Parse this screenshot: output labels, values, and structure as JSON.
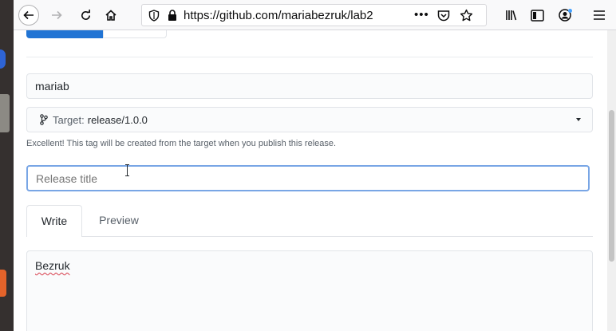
{
  "browser": {
    "url": "https://github.com/mariabezruk/lab2",
    "url_overflow": "•••",
    "icons": {
      "back": "arrow-left-icon",
      "forward": "arrow-right-icon",
      "reload": "reload-icon",
      "home": "home-icon",
      "tracking": "shield-icon",
      "secure": "lock-icon",
      "pocket": "pocket-icon",
      "bookmark": "star-icon",
      "library": "library-icon",
      "sidebar": "sidebar-icon",
      "account": "account-icon",
      "menu": "hamburger-menu-icon"
    }
  },
  "form": {
    "tag_value": "mariab",
    "target_label": "Target:",
    "target_value": "release/1.0.0",
    "hint": "Excellent! This tag will be created from the target when you publish this release.",
    "title_placeholder": "Release title",
    "tabs": [
      {
        "label": "Write",
        "active": true
      },
      {
        "label": "Preview",
        "active": false
      }
    ],
    "description": "Bezruk"
  },
  "colors": {
    "primary_button": "#2174d4",
    "focus_border": "#79a6e5",
    "spellcheck_underline": "#d73a49"
  }
}
